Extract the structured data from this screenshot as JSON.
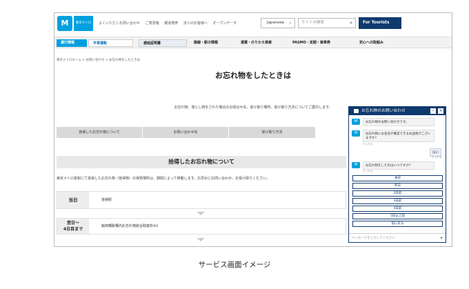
{
  "header": {
    "logo_symbol": "M",
    "logo_text": "東京メトロ",
    "top_links": [
      "よくいただくお問い合わせ",
      "ご意見箱",
      "報道発表",
      "法人のお客様へ",
      "オープンデータ"
    ],
    "language": "Japanese",
    "search_placeholder": "サイト内検索",
    "tourists_label": "For Tourists"
  },
  "nav": {
    "operation_label": "運行情報",
    "operation_status": "平常運転",
    "certificate_label": "遅延証明書",
    "menu_items": [
      "路線・駅の情報",
      "運賃・のりかえ検索",
      "PASMO・定期・乗車券",
      "安心への取組み"
    ]
  },
  "breadcrumb": "東京メトロホーム > お問い合わせ > お忘れ物をしたときは",
  "page_title": "お忘れ物をしたときは",
  "intro": "お忘れ物、落とし物をされた場合のお問合せ先、受け取り場所、受け取り方法についてご案内します。",
  "tabs": [
    "拾得したお忘れ物について",
    "お問い合わせ先",
    "受け取り方法"
  ],
  "section": {
    "title": "拾得したお忘れ物について",
    "description": "東京メトロ各駅にて拾得したお忘れ物（拾得物）の保管場所は、期間によって移動します。お早めにお問い合わせ、お受け取りください。",
    "rows": [
      {
        "label": "当日",
        "text": "拾得駅"
      },
      {
        "label": "翌日〜\n4日目まで",
        "text": "飯田橋駅構内お忘れ物総合取扱所※1"
      }
    ]
  },
  "chat": {
    "title": "お忘れ物のお問い合わせ",
    "messages": [
      {
        "side": "left",
        "text": "お忘れ物のお問い合わせです。",
        "ts": ""
      },
      {
        "side": "left",
        "text": "お忘れ物にお名前が確認できるお品物がございますか？",
        "ts": "たった今"
      },
      {
        "side": "right",
        "text": "はい",
        "ts": "たった今"
      },
      {
        "side": "left",
        "text": "お忘れ物をしたのはいつですか？",
        "ts": "たった今"
      }
    ],
    "options": [
      "本日",
      "昨日",
      "2日前",
      "3日前",
      "4日前",
      "5日以上前",
      "前に戻る"
    ],
    "input_placeholder": "メッセージを入力してください"
  },
  "caption": "サービス画面イメージ"
}
